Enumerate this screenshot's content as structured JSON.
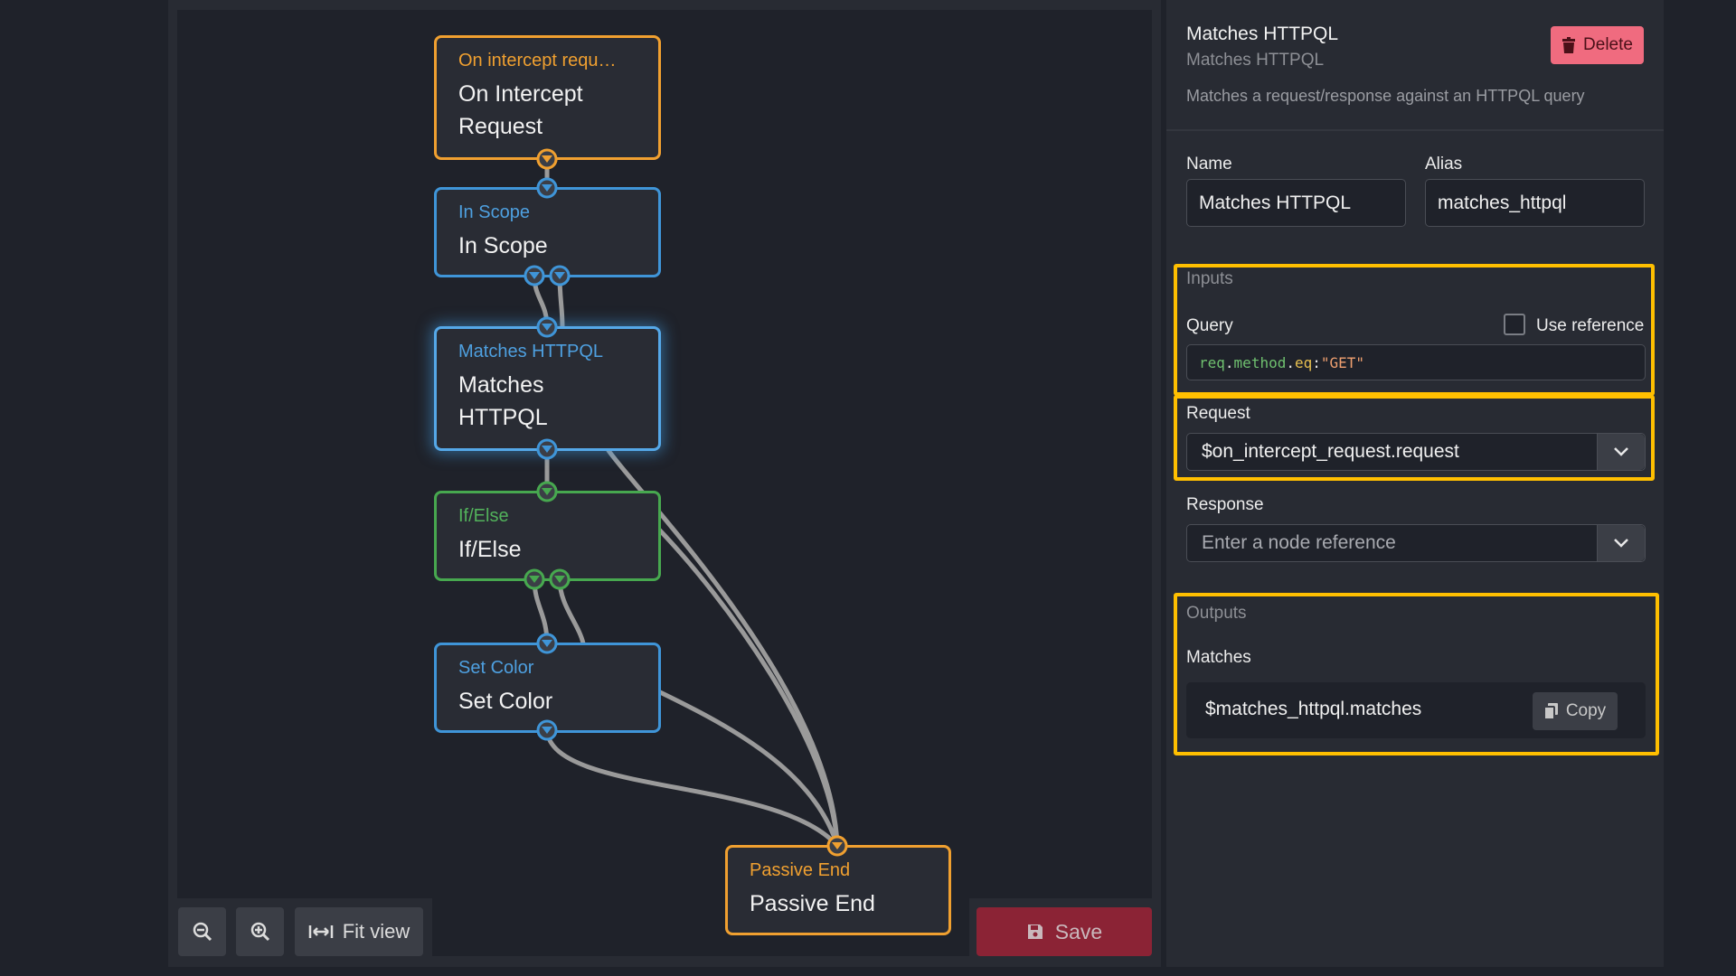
{
  "canvas": {
    "nodes": {
      "on_intercept": {
        "type": "On intercept requ…",
        "name_line1": "On Intercept",
        "name_line2": "Request"
      },
      "in_scope": {
        "type": "In Scope",
        "name_line1": "In Scope"
      },
      "matches_httpql": {
        "type": "Matches HTTPQL",
        "name_line1": "Matches",
        "name_line2": "HTTPQL"
      },
      "if_else": {
        "type": "If/Else",
        "name_line1": "If/Else"
      },
      "set_color": {
        "type": "Set Color",
        "name_line1": "Set Color"
      },
      "passive_end": {
        "type": "Passive End",
        "name_line1": "Passive End"
      }
    },
    "toolbar": {
      "zoom_out_icon": "zoom-out-icon",
      "zoom_in_icon": "zoom-in-icon",
      "fit_view_label": "Fit view"
    },
    "save_label": "Save",
    "colors": {
      "orange": "#f0a030",
      "blue": "#3f95d8",
      "green": "#47a84f",
      "edge": "#9a9a9a"
    }
  },
  "panel": {
    "title": "Matches HTTPQL",
    "subtitle": "Matches HTTPQL",
    "description": "Matches a request/response against an HTTPQL query",
    "delete_label": "Delete",
    "name_label": "Name",
    "name_value": "Matches HTTPQL",
    "alias_label": "Alias",
    "alias_value": "matches_httpql",
    "inputs_heading": "Inputs",
    "query_label": "Query",
    "use_reference_label": "Use reference",
    "query_code": {
      "p1": "req",
      "d1": ".",
      "p2": "method",
      "d2": ".",
      "p3": "eq",
      "colon": ":",
      "str": "\"GET\""
    },
    "request_label": "Request",
    "request_value": "$on_intercept_request.request",
    "response_label": "Response",
    "response_placeholder": "Enter a node reference",
    "outputs_heading": "Outputs",
    "matches_label": "Matches",
    "matches_value": "$matches_httpql.matches",
    "copy_label": "Copy"
  }
}
